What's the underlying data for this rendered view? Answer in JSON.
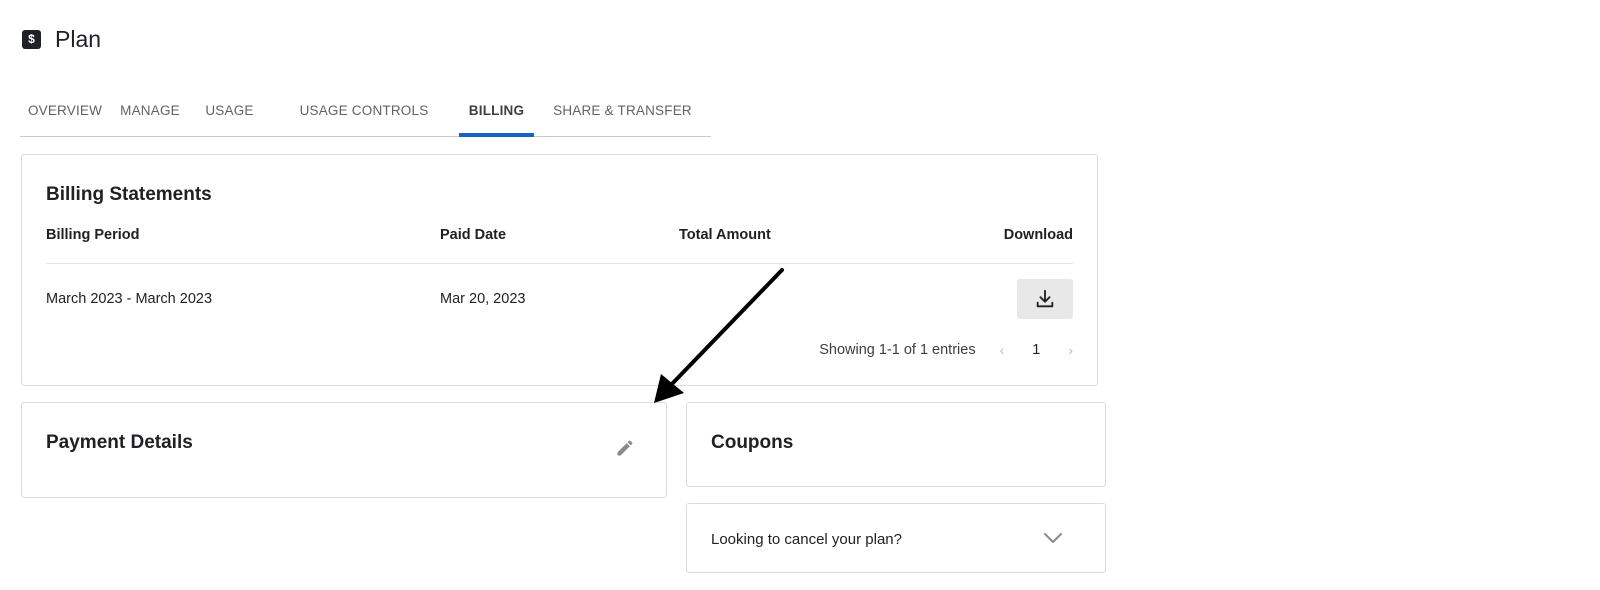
{
  "header": {
    "icon_glyph": "$",
    "icon_name": "dollar-icon",
    "title": "Plan"
  },
  "tabs": [
    {
      "label": "OVERVIEW",
      "active": false
    },
    {
      "label": "MANAGE",
      "active": false
    },
    {
      "label": "USAGE",
      "active": false
    },
    {
      "label": "USAGE CONTROLS",
      "active": false
    },
    {
      "label": "BILLING",
      "active": true
    },
    {
      "label": "SHARE & TRANSFER",
      "active": false
    }
  ],
  "billing": {
    "title": "Billing Statements",
    "columns": {
      "period": "Billing Period",
      "paid": "Paid Date",
      "total": "Total Amount",
      "download": "Download"
    },
    "rows": [
      {
        "period": "March 2023 - March 2023",
        "paid": "Mar 20, 2023",
        "total": ""
      }
    ],
    "pagination": {
      "info": "Showing 1-1 of 1 entries",
      "prev_glyph": "‹",
      "page": "1",
      "next_glyph": "›"
    }
  },
  "payment": {
    "title": "Payment Details"
  },
  "coupons": {
    "title": "Coupons"
  },
  "cancel": {
    "text": "Looking to cancel your plan?"
  },
  "colors": {
    "accent": "#1565c0",
    "text": "#202124",
    "border": "#dcdcdc",
    "button_bg": "#e8e8e8"
  }
}
